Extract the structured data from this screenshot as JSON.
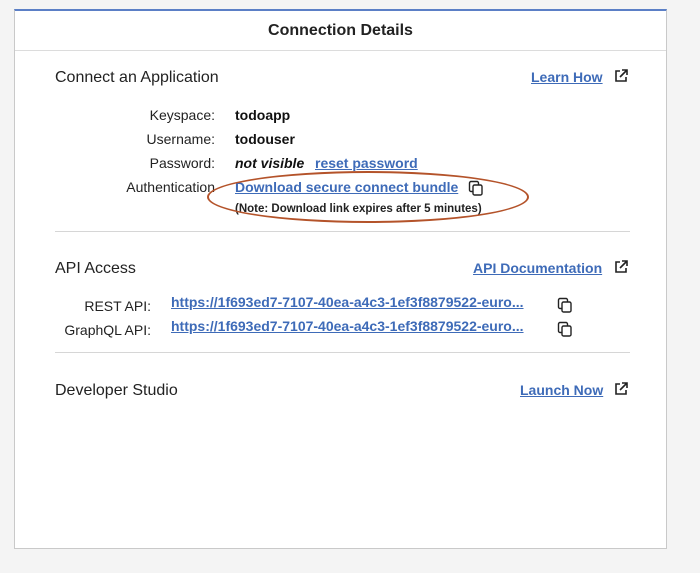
{
  "header": {
    "title": "Connection Details"
  },
  "connect_app": {
    "title": "Connect an Application",
    "learn_how": "Learn How",
    "keyspace_label": "Keyspace:",
    "keyspace_value": "todoapp",
    "username_label": "Username:",
    "username_value": "todouser",
    "password_label": "Password:",
    "password_value": "not visible",
    "reset_password": "reset password",
    "auth_label": "Authentication",
    "download_bundle": "Download secure connect bundle",
    "note": "(Note: Download link expires after 5 minutes)"
  },
  "api_access": {
    "title": "API Access",
    "doc_link": "API Documentation",
    "rest_label": "REST API:",
    "rest_url": "https://1f693ed7-7107-40ea-a4c3-1ef3f8879522-euro...",
    "graphql_label": "GraphQL API:",
    "graphql_url": "https://1f693ed7-7107-40ea-a4c3-1ef3f8879522-euro..."
  },
  "dev_studio": {
    "title": "Developer Studio",
    "launch": "Launch Now"
  },
  "colors": {
    "link": "#3e6bb8",
    "accent_border": "#5b7fc6",
    "highlight": "#b4532a"
  },
  "icons": {
    "external": "external-link-icon",
    "copy": "copy-icon"
  }
}
